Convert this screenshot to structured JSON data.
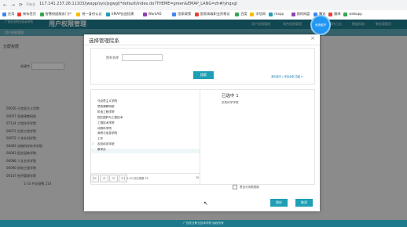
{
  "browser": {
    "nav_icons": [
      "←",
      "→",
      "⟳"
    ],
    "not_secure": "不安全",
    "url": "117.141.237.26:11103/jwapp/sys/jsgwgl/*default/index.do?THEME=green&EMAP_LANG=zh#/yhqxgl",
    "bookmarks": [
      "应用",
      "新标签页",
      "智慧校园服务门户",
      "统一身份认证",
      "EMAP自由搭建",
      "WorkAD",
      "国家政策",
      "国家高级职业资格证",
      "百度",
      "学信网",
      "mapp",
      "我的网盘",
      "腾讯",
      "翻译",
      "webapp"
    ]
  },
  "header": {
    "logo_text": "广西农业职业技术学院",
    "app_title": "用户权限管理",
    "tabs": [
      "用户权限管理",
      "角色权限管理",
      "系统维护",
      "操作日志",
      "数据权限"
    ],
    "circle_label": "角色",
    "user_text": "教务管理员"
  },
  "subbar": {
    "label": "用户权限管理"
  },
  "bg_page": {
    "section_title": "分配权限",
    "field_label": "关键字",
    "rows": [
      "00056  马克思主义学院",
      "00057  思政课教研部",
      "07134  工程技术学院",
      "00071  信息工程学院",
      "00072  人文社科学院",
      "00082  动物科学技术学院",
      "00083  园艺园林学院",
      "00088  人文艺术学院",
      "00090  机电工程学院",
      "00147  经济管理学院"
    ],
    "pager": "1-10 共记录数 214"
  },
  "modal": {
    "title": "选择管理院系",
    "close": "×",
    "filter_label": "院系名称",
    "filter_value": "",
    "query_button": "搜索",
    "filter_links": "添加选中 | 添加全部  高级 ▾",
    "list_items": [
      "马克思主义学院",
      "思政课教研部",
      "机电工程学院",
      "园艺园林与工程技术",
      "工程技术学院",
      "动物科学院",
      "商贸与信息学院",
      "工作",
      "农机科学学院",
      "教学办"
    ],
    "checked_index": 8,
    "pager_buttons": [
      "|<",
      "<",
      ">",
      ">|"
    ],
    "pager_info": "1-10 共记录数 20",
    "pager_select": "10 ▾",
    "selected_header": "已选中 1",
    "selected_items": [
      "农机科学学院"
    ],
    "checkbox_label": "是否可用数据权",
    "ok_button": "保存",
    "cancel_button": "取消"
  },
  "footer": {
    "text": "广西农业职业技术学院 版权所有"
  }
}
